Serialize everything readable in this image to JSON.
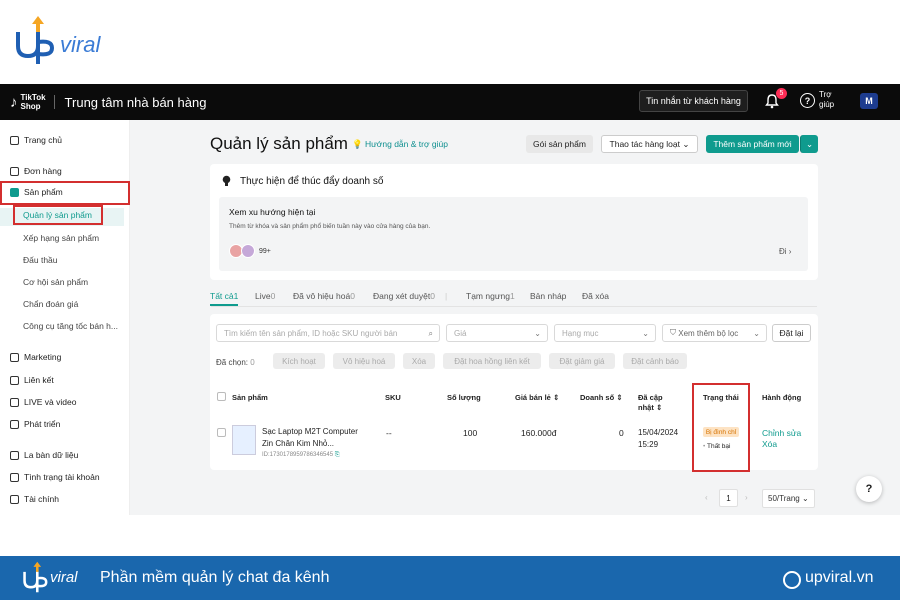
{
  "brand": {
    "logo_text": "viral",
    "footer_logo": "viral",
    "tagline": "Phần mềm quản lý chat đa kênh",
    "website": "upviral.vn"
  },
  "header": {
    "logo_line1": "TikTok",
    "logo_line2": "Shop",
    "title": "Trung tâm nhà bán hàng",
    "messages_button": "Tin nhắn từ khách hàng",
    "notification_count": "5",
    "help_label": "Trợ giúp"
  },
  "sidebar": {
    "items": [
      {
        "label": "Trang chủ"
      },
      {
        "label": "Đơn hàng"
      },
      {
        "label": "Sản phẩm"
      },
      {
        "label": "Marketing"
      },
      {
        "label": "Liên kết"
      },
      {
        "label": "LIVE và video"
      },
      {
        "label": "Phát triển"
      },
      {
        "label": "La bàn dữ liệu"
      },
      {
        "label": "Tình trạng tài khoản"
      },
      {
        "label": "Tài chính"
      }
    ],
    "subitems": [
      {
        "label": "Quản lý sản phẩm"
      },
      {
        "label": "Xếp hạng sản phẩm"
      },
      {
        "label": "Đấu thầu"
      },
      {
        "label": "Cơ hội sản phẩm"
      },
      {
        "label": "Chẩn đoán giá"
      },
      {
        "label": "Công cụ tăng tốc bán h..."
      }
    ]
  },
  "main": {
    "title": "Quản lý sản phẩm",
    "guide_link": "Hướng dẫn & trợ giúp",
    "btn_bundle": "Gói sản phẩm",
    "btn_bulk": "Thao tác hàng loạt",
    "btn_add": "Thêm sản phẩm mới",
    "promo": {
      "title": "Thực hiện để thúc đẩy doanh số",
      "trend_title": "Xem xu hướng hiện tại",
      "trend_desc": "Thêm từ khóa và sản phẩm phổ biến tuần này vào cửa hàng của bạn.",
      "count": "99+",
      "go": "Đi"
    },
    "tabs": [
      {
        "label": "Tất cả",
        "count": "1"
      },
      {
        "label": "Live",
        "count": "0"
      },
      {
        "label": "Đã vô hiệu hoá",
        "count": "0"
      },
      {
        "label": "Đang xét duyệt",
        "count": "0"
      },
      {
        "label": "Tạm ngưng",
        "count": "1"
      },
      {
        "label": "Bản nháp",
        "count": ""
      },
      {
        "label": "Đã xóa",
        "count": ""
      }
    ],
    "filters": {
      "search_placeholder": "Tìm kiếm tên sản phẩm, ID hoặc SKU người bán",
      "price_placeholder": "Giá",
      "category_placeholder": "Hạng mục",
      "more_filters": "Xem thêm bộ lọc",
      "reset": "Đặt lại"
    },
    "selected_label": "Đã chọn:",
    "selected_count": "0",
    "bulk_actions": [
      "Kích hoạt",
      "Vô hiệu hoá",
      "Xóa",
      "Đặt hoa hồng liên kết",
      "Đặt giảm giá",
      "Đặt cảnh báo"
    ],
    "columns": {
      "product": "Sản phẩm",
      "sku": "SKU",
      "quantity": "Số lượng",
      "retail_price": "Giá bán lẻ",
      "sales": "Doanh số",
      "updated": "Đã cập nhật",
      "status": "Trạng thái",
      "actions": "Hành động"
    },
    "rows": [
      {
        "name_line1": "Sạc Laptop M2T Computer",
        "name_line2": "Zin Chân Kim Nhỏ...",
        "id": "ID:1730178959786346545",
        "sku": "--",
        "quantity": "100",
        "price": "160.000đ",
        "sales": "0",
        "updated_date": "15/04/2024",
        "updated_time": "15:29",
        "status": "Bị đình chỉ",
        "status_note": "Thất bại",
        "action_edit": "Chỉnh sửa",
        "action_delete": "Xóa"
      }
    ],
    "pagination": {
      "current": "1",
      "per_page": "50/Trang"
    }
  },
  "colors": {
    "accent": "#0f9b8e",
    "header_bg": "#0b0b0b",
    "footer_bg": "#1a67ad",
    "highlight": "#d32f2f"
  }
}
